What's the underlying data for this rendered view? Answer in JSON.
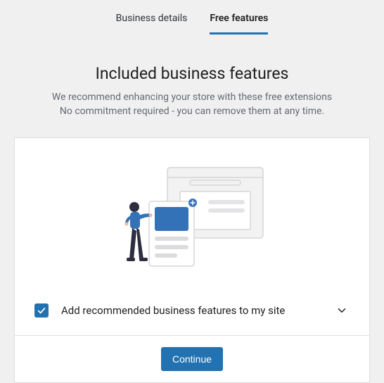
{
  "tabs": {
    "business_details": "Business details",
    "free_features": "Free features"
  },
  "header": {
    "title": "Included business features",
    "subtitle_line1": "We recommend enhancing your store with these free extensions",
    "subtitle_line2": "No commitment required - you can remove them at any time."
  },
  "option": {
    "checked": true,
    "label": "Add recommended business features to my site"
  },
  "actions": {
    "continue": "Continue"
  }
}
